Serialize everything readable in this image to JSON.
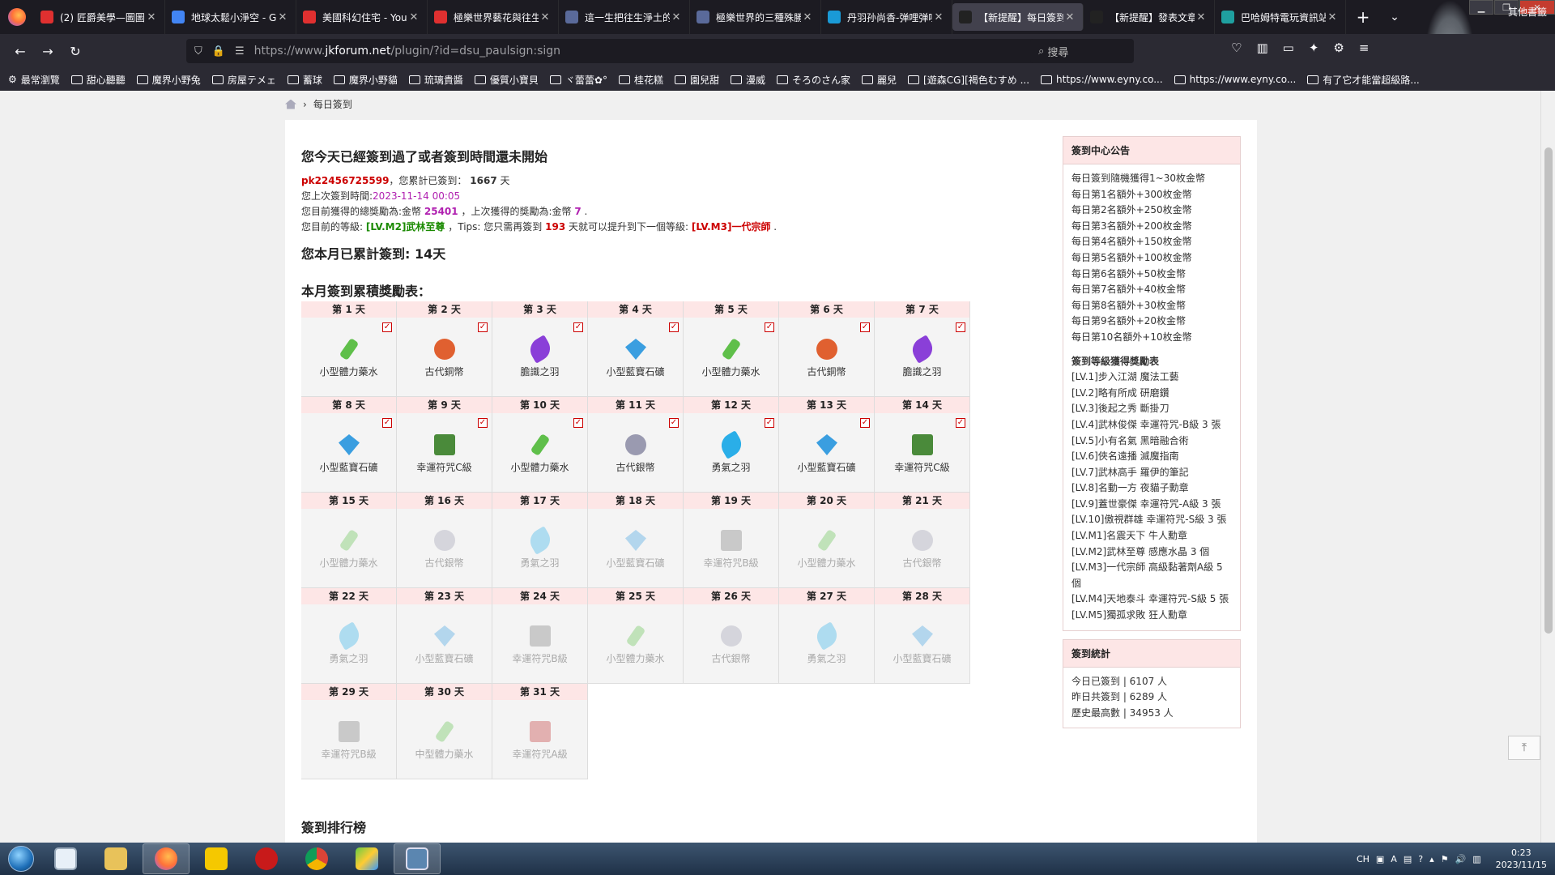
{
  "browser": {
    "tabs": [
      {
        "title": "(2) 匠爵美學—圖圖"
      },
      {
        "title": "地球太鬆小淨空 - G"
      },
      {
        "title": "美國科幻住宅 - You"
      },
      {
        "title": "極樂世界藝花與往生"
      },
      {
        "title": "這一生把往生淨土的"
      },
      {
        "title": "極樂世界的三種殊勝"
      },
      {
        "title": "丹羽孙尚香-弹哩弹哩"
      },
      {
        "title": "【新提醒】每日簽到"
      },
      {
        "title": "【新提醒】發表文章"
      },
      {
        "title": "巴哈姆特電玩資訊站"
      }
    ],
    "url_prefix": "https://www.",
    "url_host": "jkforum.net",
    "url_path": "/plugin/?id=dsu_paulsign:sign",
    "search_placeholder": "搜尋",
    "bookmarks": [
      "最常瀏覽",
      "甜心聽聽",
      "魔界小野兔",
      "房屋テメェ",
      "蓄球",
      "魔界小野貓",
      "琉璃貴醬",
      "優質小寶貝",
      "ヾ蕾蕾✿°",
      "桂花糕",
      "園兒甜",
      "漫威",
      "そろのさん家",
      "麗兒",
      "[遊森CG][褐色むすめ ...",
      "https://www.eyny.co...",
      "https://www.eyny.co...",
      "有了它才能當超級路..."
    ],
    "bookmarks_other": "其他書籤"
  },
  "page": {
    "breadcrumb": "每日簽到",
    "main_title": "您今天已經簽到過了或者簽到時間還未開始",
    "username": "pk22456725599",
    "total_label": "，您累計已簽到：",
    "total_days": "1667",
    "days_unit": "天",
    "last_sign_label": "您上次簽到時間:",
    "last_sign_time": "2023-11-14 00:05",
    "reward_label": "您目前獲得的總獎勵為:金幣",
    "total_coins": "25401",
    "last_reward_label": "，上次獲得的獎勵為:金幣",
    "last_reward": "7",
    "level_label": "您目前的等級:",
    "current_level": "[LV.M2]武林至尊",
    "tips_label": "，Tips: 您只需再簽到",
    "need_days": "193",
    "tips_label2": "天就可以提升到下一個等級:",
    "next_level": "[LV.M3]一代宗師",
    "month_total": "您本月已累計簽到: 14天",
    "table_title": "本月簽到累積獎勵表：",
    "ranking_title": "簽到排行榜"
  },
  "rewards": [
    {
      "day": "第 1 天",
      "item": "小型體力藥水",
      "kind": "potion",
      "color": "#5fbf4a",
      "done": true
    },
    {
      "day": "第 2 天",
      "item": "古代銅幣",
      "kind": "coin",
      "color": "#e06030",
      "done": true
    },
    {
      "day": "第 3 天",
      "item": "膽識之羽",
      "kind": "feather",
      "color": "#8a3fd8",
      "done": true
    },
    {
      "day": "第 4 天",
      "item": "小型藍寶石礦",
      "kind": "gem",
      "color": "#3a9ee0",
      "done": true
    },
    {
      "day": "第 5 天",
      "item": "小型體力藥水",
      "kind": "potion",
      "color": "#5fbf4a",
      "done": true
    },
    {
      "day": "第 6 天",
      "item": "古代銅幣",
      "kind": "coin",
      "color": "#e06030",
      "done": true
    },
    {
      "day": "第 7 天",
      "item": "膽識之羽",
      "kind": "feather",
      "color": "#8a3fd8",
      "done": true
    },
    {
      "day": "第 8 天",
      "item": "小型藍寶石礦",
      "kind": "gem",
      "color": "#3a9ee0",
      "done": true
    },
    {
      "day": "第 9 天",
      "item": "幸運符咒C級",
      "kind": "rune",
      "color": "#4a8a3a",
      "done": true
    },
    {
      "day": "第 10 天",
      "item": "小型體力藥水",
      "kind": "potion",
      "color": "#5fbf4a",
      "done": true
    },
    {
      "day": "第 11 天",
      "item": "古代銀幣",
      "kind": "coin",
      "color": "#9a9ab0",
      "done": true
    },
    {
      "day": "第 12 天",
      "item": "勇氣之羽",
      "kind": "feather",
      "color": "#2aaee8",
      "done": true
    },
    {
      "day": "第 13 天",
      "item": "小型藍寶石礦",
      "kind": "gem",
      "color": "#3a9ee0",
      "done": true
    },
    {
      "day": "第 14 天",
      "item": "幸運符咒C級",
      "kind": "rune",
      "color": "#4a8a3a",
      "done": true
    },
    {
      "day": "第 15 天",
      "item": "小型體力藥水",
      "kind": "potion",
      "color": "#5fbf4a",
      "done": false
    },
    {
      "day": "第 16 天",
      "item": "古代銀幣",
      "kind": "coin",
      "color": "#9a9ab0",
      "done": false
    },
    {
      "day": "第 17 天",
      "item": "勇氣之羽",
      "kind": "feather",
      "color": "#2aaee8",
      "done": false
    },
    {
      "day": "第 18 天",
      "item": "小型藍寶石礦",
      "kind": "gem",
      "color": "#3a9ee0",
      "done": false
    },
    {
      "day": "第 19 天",
      "item": "幸運符咒B級",
      "kind": "rune",
      "color": "#777",
      "done": false
    },
    {
      "day": "第 20 天",
      "item": "小型體力藥水",
      "kind": "potion",
      "color": "#5fbf4a",
      "done": false
    },
    {
      "day": "第 21 天",
      "item": "古代銀幣",
      "kind": "coin",
      "color": "#9a9ab0",
      "done": false
    },
    {
      "day": "第 22 天",
      "item": "勇氣之羽",
      "kind": "feather",
      "color": "#2aaee8",
      "done": false
    },
    {
      "day": "第 23 天",
      "item": "小型藍寶石礦",
      "kind": "gem",
      "color": "#3a9ee0",
      "done": false
    },
    {
      "day": "第 24 天",
      "item": "幸運符咒B級",
      "kind": "rune",
      "color": "#777",
      "done": false
    },
    {
      "day": "第 25 天",
      "item": "小型體力藥水",
      "kind": "potion",
      "color": "#5fbf4a",
      "done": false
    },
    {
      "day": "第 26 天",
      "item": "古代銀幣",
      "kind": "coin",
      "color": "#9a9ab0",
      "done": false
    },
    {
      "day": "第 27 天",
      "item": "勇氣之羽",
      "kind": "feather",
      "color": "#2aaee8",
      "done": false
    },
    {
      "day": "第 28 天",
      "item": "小型藍寶石礦",
      "kind": "gem",
      "color": "#3a9ee0",
      "done": false
    },
    {
      "day": "第 29 天",
      "item": "幸運符咒B級",
      "kind": "rune",
      "color": "#777",
      "done": false
    },
    {
      "day": "第 30 天",
      "item": "中型體力藥水",
      "kind": "potion",
      "color": "#5fbf4a",
      "done": false
    },
    {
      "day": "第 31 天",
      "item": "幸運符咒A級",
      "kind": "rune",
      "color": "#c03030",
      "done": false
    }
  ],
  "sidebar": {
    "notice_title": "簽到中心公告",
    "notice_lines": [
      "每日簽到隨機獲得1~30枚金幣",
      "每日第1名額外+300枚金幣",
      "每日第2名額外+250枚金幣",
      "每日第3名額外+200枚金幣",
      "每日第4名額外+150枚金幣",
      "每日第5名額外+100枚金幣",
      "每日第6名額外+50枚金幣",
      "每日第7名額外+40枚金幣",
      "每日第8名額外+30枚金幣",
      "每日第9名額外+20枚金幣",
      "每日第10名額外+10枚金幣"
    ],
    "level_title": "簽到等級獲得獎勵表",
    "level_lines": [
      "[LV.1]步入江湖 魔法工藝",
      "[LV.2]略有所成 研磨鑽",
      "[LV.3]後起之秀 斷掛刀",
      "[LV.4]武林俊傑 幸運符咒-B級 3 張",
      "[LV.5]小有名氣 黑暗融合術",
      "[LV.6]俠名遠播 滅魔指南",
      "[LV.7]武林高手 羅伊的筆記",
      "[LV.8]名動一方 夜貓子勳章",
      "[LV.9]蓋世豪傑 幸運符咒-A級 3 張",
      "[LV.10]傲視群雄 幸運符咒-S級 3 張",
      "[LV.M1]名震天下 牛人勳章",
      "[LV.M2]武林至尊 感應水晶 3 個",
      "[LV.M3]一代宗師 高級黏著劑A級 5 個",
      "[LV.M4]天地泰斗 幸運符咒-S級 5 張",
      "[LV.M5]獨孤求敗 狂人勳章"
    ],
    "stats_title": "簽到統計",
    "stats_lines": [
      "今日已簽到 | 6107 人",
      "昨日共簽到 | 6289 人",
      "歷史最高數 | 34953 人"
    ]
  },
  "taskbar": {
    "lang": "CH",
    "time": "0:23",
    "date": "2023/11/15"
  }
}
